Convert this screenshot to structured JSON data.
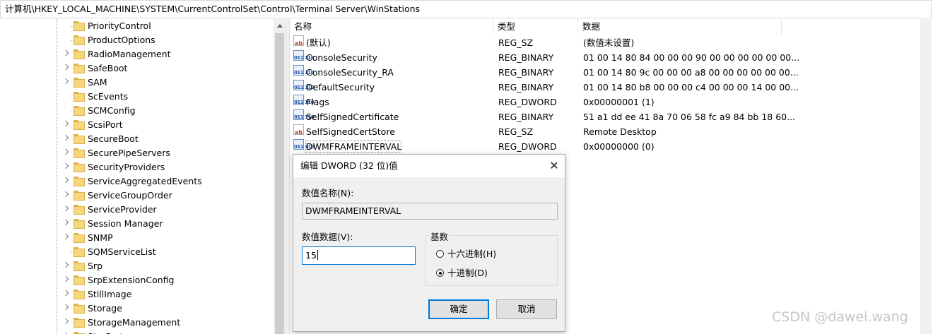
{
  "address_bar": {
    "path": "计算机\\HKEY_LOCAL_MACHINE\\SYSTEM\\CurrentControlSet\\Control\\Terminal Server\\WinStations"
  },
  "tree": {
    "items": [
      {
        "label": "PriorityControl",
        "expandable": false
      },
      {
        "label": "ProductOptions",
        "expandable": false
      },
      {
        "label": "RadioManagement",
        "expandable": true
      },
      {
        "label": "SafeBoot",
        "expandable": true
      },
      {
        "label": "SAM",
        "expandable": true
      },
      {
        "label": "ScEvents",
        "expandable": false
      },
      {
        "label": "SCMConfig",
        "expandable": false
      },
      {
        "label": "ScsiPort",
        "expandable": true
      },
      {
        "label": "SecureBoot",
        "expandable": true
      },
      {
        "label": "SecurePipeServers",
        "expandable": true
      },
      {
        "label": "SecurityProviders",
        "expandable": true
      },
      {
        "label": "ServiceAggregatedEvents",
        "expandable": true
      },
      {
        "label": "ServiceGroupOrder",
        "expandable": true
      },
      {
        "label": "ServiceProvider",
        "expandable": true
      },
      {
        "label": "Session Manager",
        "expandable": true
      },
      {
        "label": "SNMP",
        "expandable": true
      },
      {
        "label": "SQMServiceList",
        "expandable": false
      },
      {
        "label": "Srp",
        "expandable": true
      },
      {
        "label": "SrpExtensionConfig",
        "expandable": true
      },
      {
        "label": "StillImage",
        "expandable": true
      },
      {
        "label": "Storage",
        "expandable": true
      },
      {
        "label": "StorageManagement",
        "expandable": true
      },
      {
        "label": "StorPort",
        "expandable": true
      }
    ]
  },
  "values_pane": {
    "columns": {
      "name": "名称",
      "type": "类型",
      "data": "数据"
    },
    "rows": [
      {
        "icon": "string-value-icon",
        "name": "(默认)",
        "type": "REG_SZ",
        "data": "(数值未设置)"
      },
      {
        "icon": "binary-value-icon",
        "name": "ConsoleSecurity",
        "type": "REG_BINARY",
        "data": "01 00 14 80 84 00 00 00 90 00 00 00 00 00 00..."
      },
      {
        "icon": "binary-value-icon",
        "name": "ConsoleSecurity_RA",
        "type": "REG_BINARY",
        "data": "01 00 14 80 9c 00 00 00 a8 00 00 00 00 00 00..."
      },
      {
        "icon": "binary-value-icon",
        "name": "DefaultSecurity",
        "type": "REG_BINARY",
        "data": "01 00 14 80 b8 00 00 00 c4 00 00 00 14 00 00..."
      },
      {
        "icon": "binary-value-icon",
        "name": "Flags",
        "type": "REG_DWORD",
        "data": "0x00000001 (1)"
      },
      {
        "icon": "binary-value-icon",
        "name": "SelfSignedCertificate",
        "type": "REG_BINARY",
        "data": "51 a1 dd ee 41 8a 70 06 58 fc a9 84 bb 18 60..."
      },
      {
        "icon": "string-value-icon",
        "name": "SelfSignedCertStore",
        "type": "REG_SZ",
        "data": "Remote Desktop"
      },
      {
        "icon": "binary-value-icon",
        "name": "DWMFRAMEINTERVAL",
        "type": "REG_DWORD",
        "data": "0x00000000 (0)"
      }
    ],
    "icon_glyphs": {
      "string": "ab",
      "binary": "011 110"
    }
  },
  "dialog": {
    "title": "编辑 DWORD (32 位)值",
    "close_glyph": "✕",
    "value_name_label": "数值名称(N):",
    "value_name": "DWMFRAMEINTERVAL",
    "value_data_label": "数值数据(V):",
    "value_data": "15",
    "base_label": "基数",
    "radix_options": [
      {
        "label": "十六进制(H)",
        "selected": false
      },
      {
        "label": "十进制(D)",
        "selected": true
      }
    ],
    "ok_label": "确定",
    "cancel_label": "取消"
  },
  "watermark": "CSDN @dawei.wang",
  "colors": {
    "accent": "#0078d7",
    "folder": "#f6d77d",
    "folder_edge": "#dcb14a",
    "dialog_bg": "#f0f0f0"
  }
}
